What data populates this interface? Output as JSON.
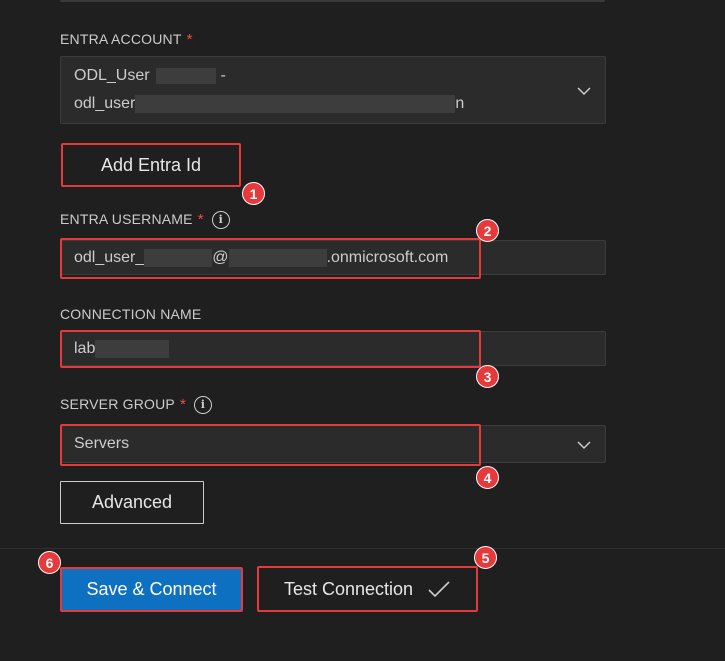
{
  "account": {
    "label": "ENTRA ACCOUNT",
    "required_mark": "*",
    "line1_prefix": "ODL_User",
    "line1_suffix": "-",
    "line2_prefix": "odl_user",
    "line2_suffix": "n"
  },
  "add_entra": {
    "label": "Add Entra Id"
  },
  "username": {
    "label": "ENTRA USERNAME",
    "required_mark": "*",
    "info": "i",
    "value_prefix": "odl_user_",
    "value_at": "@",
    "value_domain": ".onmicrosoft.com"
  },
  "connection": {
    "label": "CONNECTION NAME",
    "value_prefix": "lab"
  },
  "server_group": {
    "label": "SERVER GROUP",
    "required_mark": "*",
    "info": "i",
    "value": "Servers"
  },
  "advanced": {
    "label": "Advanced"
  },
  "footer": {
    "save_connect": "Save & Connect",
    "test_connection": "Test Connection"
  },
  "annotations": [
    "1",
    "2",
    "3",
    "4",
    "5",
    "6"
  ],
  "colors": {
    "background": "#1f1f1f",
    "field": "#2b2b2b",
    "primary_button": "#0e70c0",
    "highlight": "#e5393c",
    "required": "#f14c4c"
  },
  "icons": {
    "dropdown": "chevron-down-icon",
    "info": "info-icon",
    "check": "checkmark-icon"
  }
}
